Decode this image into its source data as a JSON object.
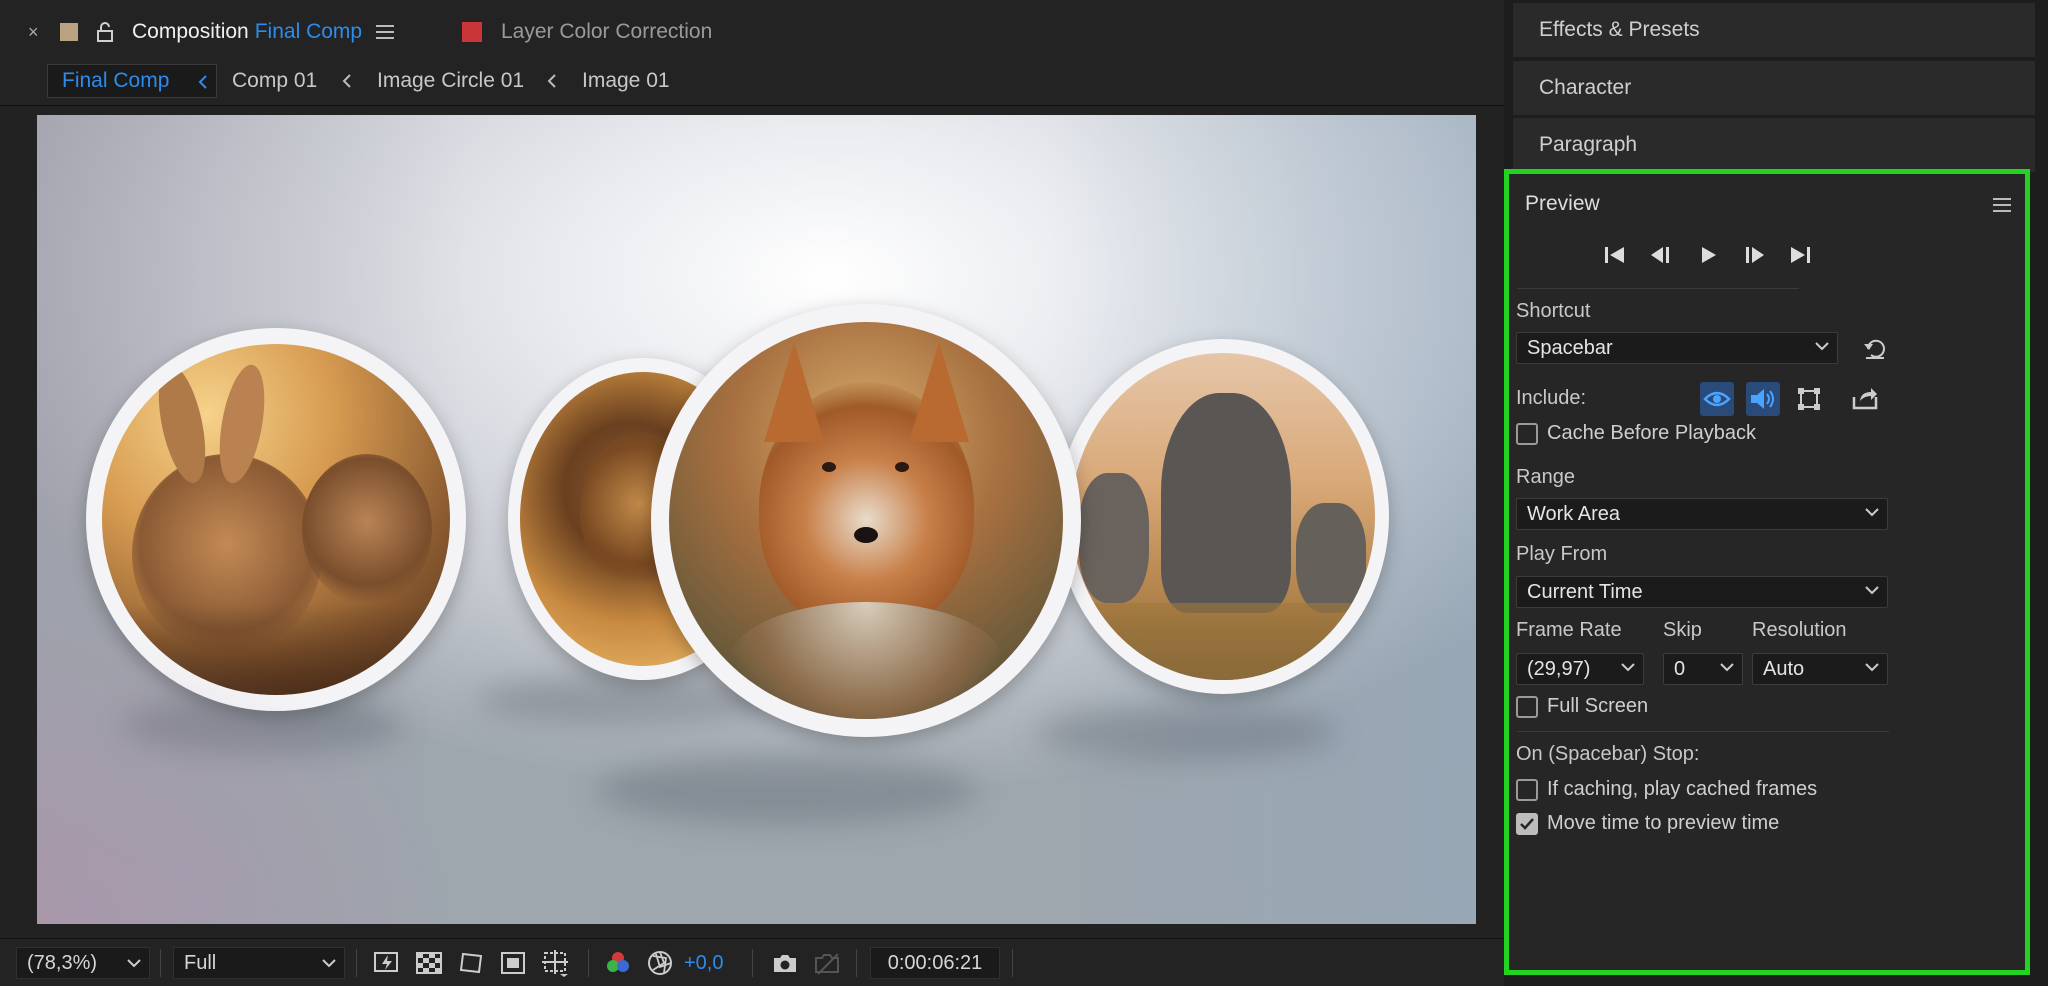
{
  "composition_tab": {
    "close": "×",
    "label": "Composition",
    "name": "Final Comp",
    "menu": "≡"
  },
  "layer_tab": {
    "label": "Layer Color Correction"
  },
  "breadcrumbs": [
    "Final Comp",
    "Comp 01",
    "Image Circle 01",
    "Image 01"
  ],
  "viewer": {
    "circles": [
      "rabbits",
      "lion",
      "fox",
      "elephants"
    ]
  },
  "bottom_toolbar": {
    "zoom": "(78,3%)",
    "resolution": "Full",
    "exposure": "+0,0",
    "timecode": "0:00:06:21"
  },
  "right_panels": {
    "effects_presets": "Effects & Presets",
    "character": "Character",
    "paragraph": "Paragraph"
  },
  "preview": {
    "title": "Preview",
    "shortcut_label": "Shortcut",
    "shortcut_value": "Spacebar",
    "include_label": "Include:",
    "cache_before_playback": "Cache Before Playback",
    "range_label": "Range",
    "range_value": "Work Area",
    "play_from_label": "Play From",
    "play_from_value": "Current Time",
    "frame_rate_label": "Frame Rate",
    "frame_rate_value": "(29,97)",
    "skip_label": "Skip",
    "skip_value": "0",
    "resolution_label": "Resolution",
    "resolution_value": "Auto",
    "full_screen": "Full Screen",
    "stop_label": "On (Spacebar) Stop:",
    "if_caching": "If caching, play cached frames",
    "move_time": "Move time to preview time",
    "checkboxes": {
      "cache_before_playback": false,
      "full_screen": false,
      "if_caching": false,
      "move_time": true
    }
  },
  "colors": {
    "accent_blue": "#2d8ceb",
    "highlight_green": "#22d322",
    "layer_red": "#c8363a",
    "comp_swatch": "#b8a282"
  }
}
